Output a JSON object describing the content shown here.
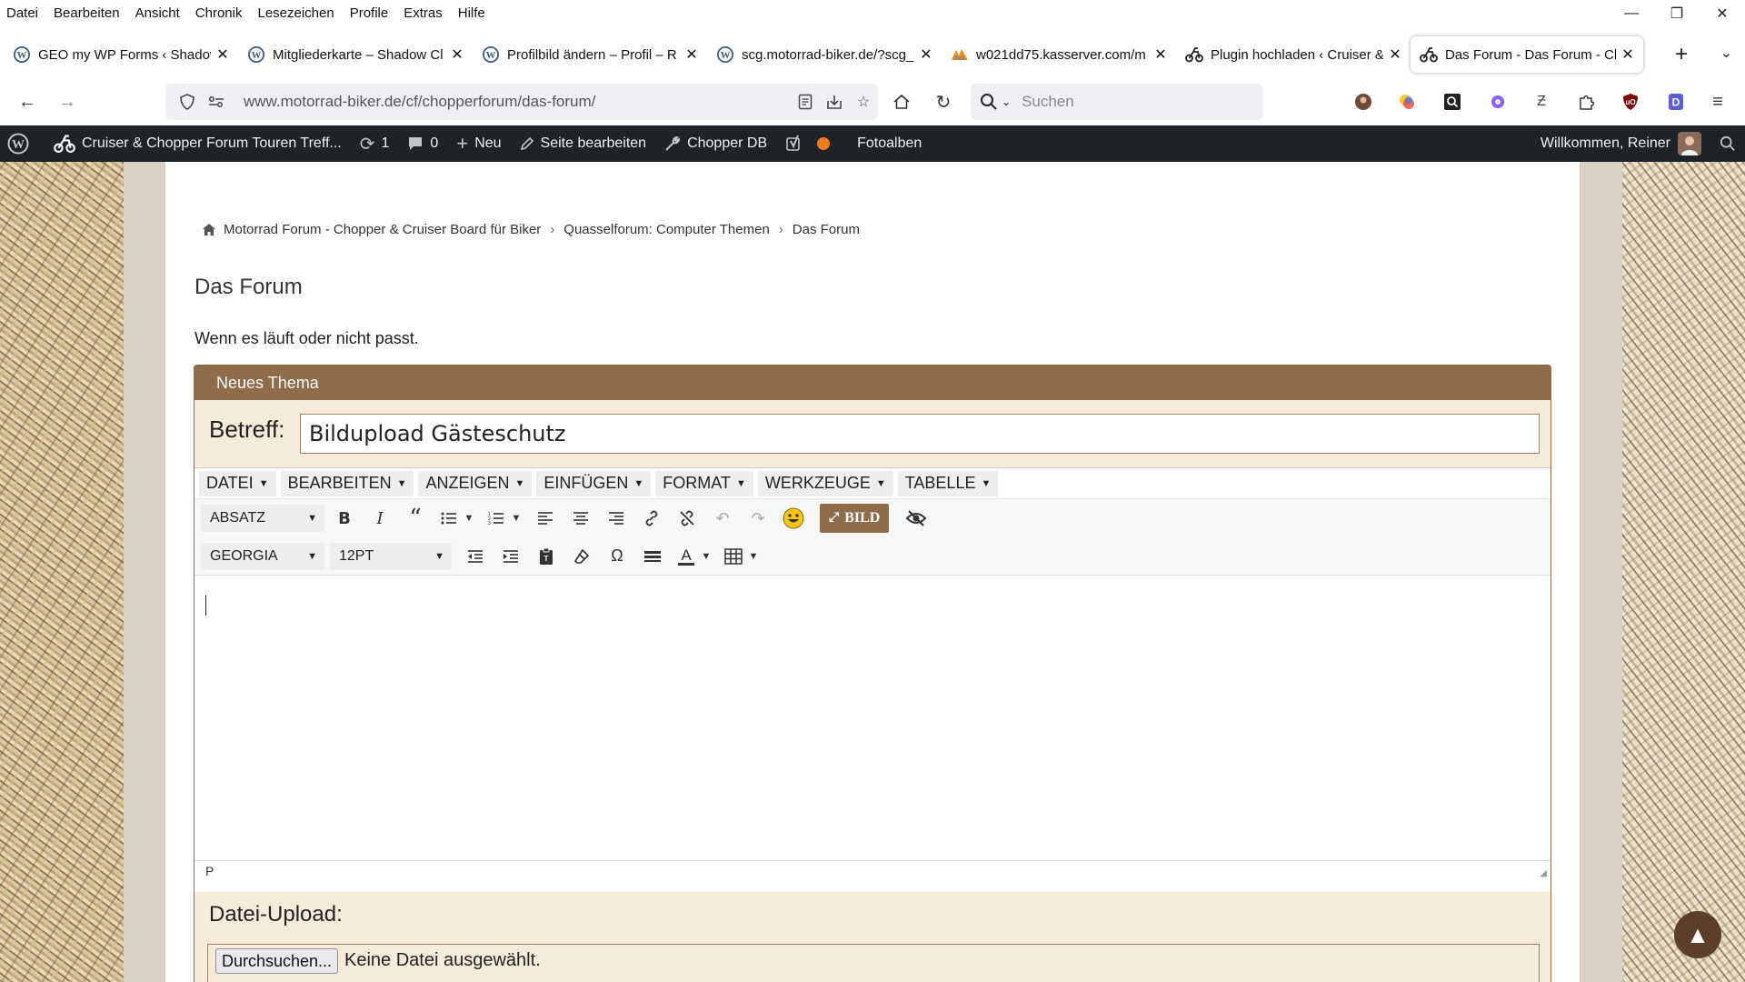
{
  "menubar": {
    "items": [
      "Datei",
      "Bearbeiten",
      "Ansicht",
      "Chronik",
      "Lesezeichen",
      "Profile",
      "Extras",
      "Hilfe"
    ]
  },
  "window": {
    "minimize": "—",
    "restore": "❐",
    "close": "✕"
  },
  "tabs": [
    {
      "title": "GEO my WP Forms ‹ Shadow",
      "icon": "wordpress-icon"
    },
    {
      "title": "Mitgliederkarte – Shadow Cl",
      "icon": "wordpress-icon"
    },
    {
      "title": "Profilbild ändern – Profil – R",
      "icon": "wordpress-icon"
    },
    {
      "title": "scg.motorrad-biker.de/?scg_",
      "icon": "wordpress-icon"
    },
    {
      "title": "w021dd75.kasserver.com/m",
      "icon": "phpmyadmin-icon"
    },
    {
      "title": "Plugin hochladen ‹ Cruiser &",
      "icon": "motorcycle-icon"
    },
    {
      "title": "Das Forum - Das Forum - Ch",
      "icon": "motorcycle-icon",
      "active": true
    }
  ],
  "navbar": {
    "url": "www.motorrad-biker.de/cf/chopperforum/das-forum/",
    "search_placeholder": "Suchen"
  },
  "wpbar": {
    "site_name": "Cruiser & Chopper Forum Touren Treff...",
    "updates": "1",
    "comments": "0",
    "new": "Neu",
    "edit_page": "Seite bearbeiten",
    "chopper_db": "Chopper DB",
    "photo_albums": "Fotoalben",
    "welcome": "Willkommen, Reiner"
  },
  "breadcrumb": [
    "Motorrad Forum - Chopper & Cruiser Board für Biker",
    "Quasselforum: Computer Themen",
    "Das Forum"
  ],
  "page": {
    "title": "Das Forum",
    "description": "Wenn es läuft oder nicht passt."
  },
  "form": {
    "header": "Neues Thema",
    "subject_label": "Betreff:",
    "subject_value": "Bildupload Gästeschutz",
    "editor_menus": [
      "Datei",
      "Bearbeiten",
      "Anzeigen",
      "Einfügen",
      "Format",
      "Werkzeuge",
      "Tabelle"
    ],
    "block_format": "Absatz",
    "font_family_value": "Georgia",
    "font_size": "12pt",
    "image_button": "BILD",
    "status_path": "P",
    "upload_label": "Datei-Upload:",
    "browse_button": "Durchsuchen...",
    "no_file": "Keine Datei ausgewählt."
  },
  "colors": {
    "accent_brown": "#8f6c4a",
    "panel_bg": "#f6ead8",
    "wp_admin_bar": "#1d2327"
  }
}
